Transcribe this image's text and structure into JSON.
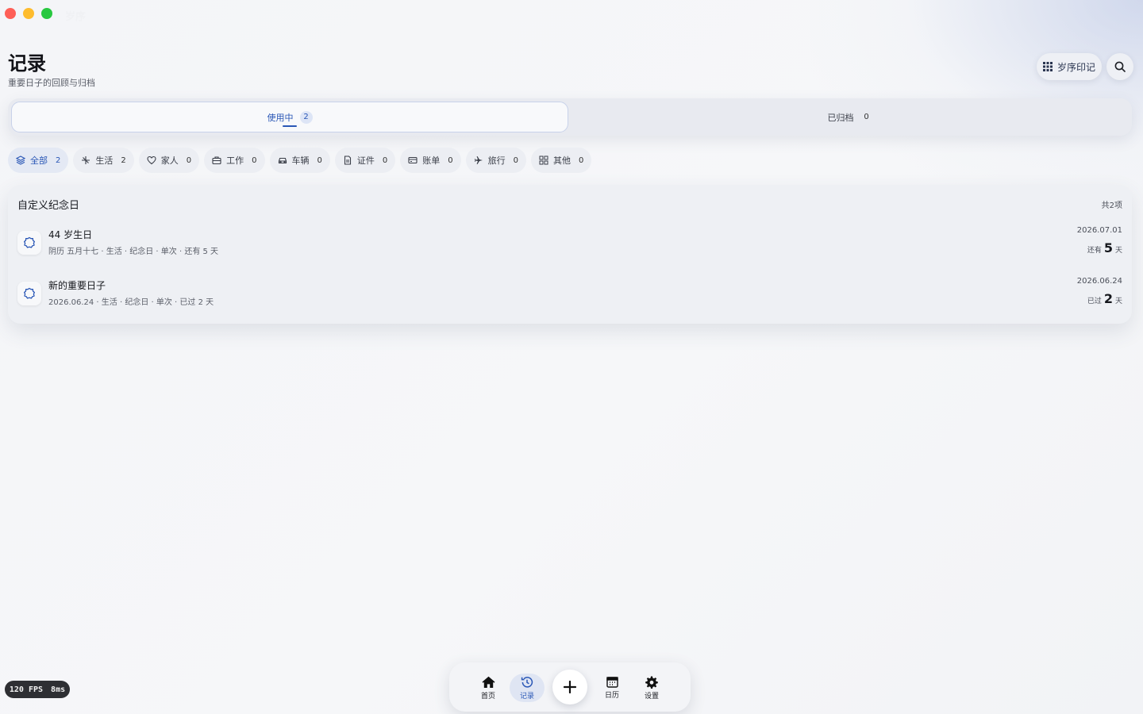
{
  "window": {
    "title": "岁序"
  },
  "header": {
    "title": "记录",
    "subtitle": "重要日子的回顾与归档",
    "suixu_button": "岁序印记"
  },
  "tabs": [
    {
      "label": "使用中",
      "count": "2"
    },
    {
      "label": "已归档",
      "count": "0"
    }
  ],
  "categories": [
    {
      "label": "全部",
      "count": "2",
      "icon": "layers-icon"
    },
    {
      "label": "生活",
      "count": "2",
      "icon": "sparkle-icon"
    },
    {
      "label": "家人",
      "count": "0",
      "icon": "heart-icon"
    },
    {
      "label": "工作",
      "count": "0",
      "icon": "briefcase-icon"
    },
    {
      "label": "车辆",
      "count": "0",
      "icon": "car-icon"
    },
    {
      "label": "证件",
      "count": "0",
      "icon": "document-icon"
    },
    {
      "label": "账单",
      "count": "0",
      "icon": "card-icon"
    },
    {
      "label": "旅行",
      "count": "0",
      "icon": "plane-icon"
    },
    {
      "label": "其他",
      "count": "0",
      "icon": "grid-icon"
    }
  ],
  "section": {
    "title": "自定义纪念日",
    "total": "共2项",
    "items": [
      {
        "name": "44 岁生日",
        "meta": "阴历 五月十七 · 生活 · 纪念日 · 单次 · 还有 5 天",
        "date": "2026.07.01",
        "prefix": "还有",
        "num": "5",
        "unit": "天"
      },
      {
        "name": "新的重要日子",
        "meta": "2026.06.24 · 生活 · 纪念日 · 单次 · 已过 2 天",
        "date": "2026.06.24",
        "prefix": "已过",
        "num": "2",
        "unit": "天"
      }
    ]
  },
  "fps": {
    "fps": "120 FPS",
    "ms": "8ms"
  },
  "nav": [
    {
      "label": "首页",
      "icon": "home-icon"
    },
    {
      "label": "记录",
      "icon": "history-icon"
    },
    {
      "label": "日历",
      "icon": "calendar-icon"
    },
    {
      "label": "设置",
      "icon": "gear-icon"
    }
  ],
  "colors": {
    "accent": "#2a57b6",
    "background": "#f5f6f8"
  }
}
